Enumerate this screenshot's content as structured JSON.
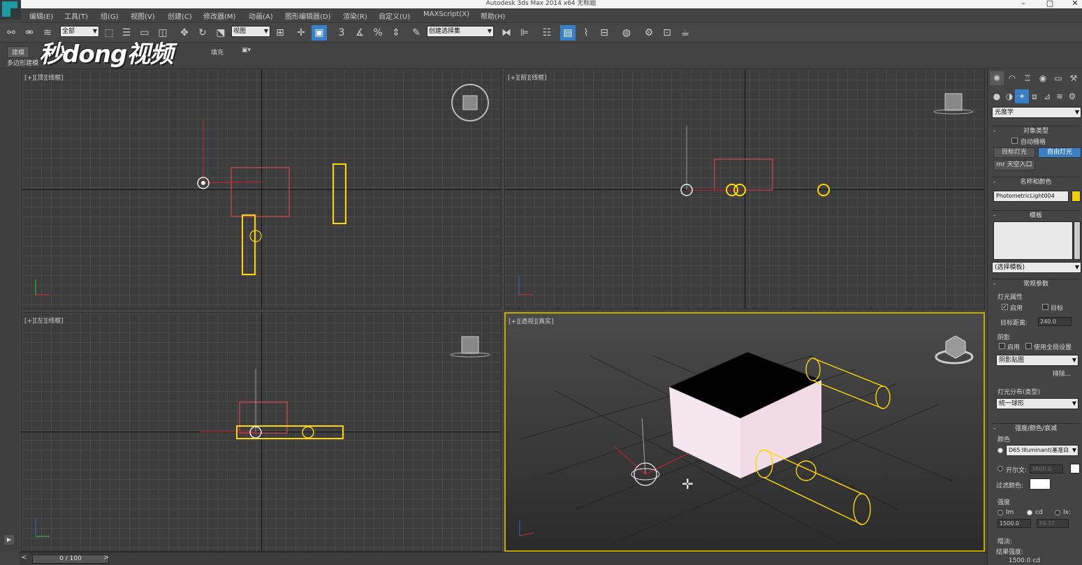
{
  "titlebar": {
    "title": "Autodesk 3ds Max  2014 x64     无标题"
  },
  "menu": [
    "编辑(E)",
    "工具(T)",
    "组(G)",
    "视图(V)",
    "创建(C)",
    "修改器(M)",
    "动画(A)",
    "图形编辑器(D)",
    "渲染(R)",
    "自定义(U)",
    "MAXScript(X)",
    "帮助(H)"
  ],
  "toolbar": {
    "filter_value": "全部",
    "refcoord_value": "视图",
    "selset_value": "创建选择集",
    "snap_num": "3"
  },
  "ribbon": {
    "tab_modeling": "建模",
    "tab_fill": "填充",
    "sub_label": "多边形建模"
  },
  "watermark": "秒dong视频",
  "viewports": {
    "top": "[+][顶][线框]",
    "front": "[+][前][线框]",
    "left": "[+][左][线框]",
    "persp": "[+][透视][真实]"
  },
  "cmd": {
    "category": "光度学",
    "obj_type_header": "对象类型",
    "autogrid": "自动栅格",
    "btn_target_light": "目标灯光",
    "btn_free_light": "自由灯光",
    "btn_sky_portal": "mr 天空入口",
    "name_color_header": "名称和颜色",
    "object_name": "PhotometricLight004",
    "object_color": "#f0d000",
    "template_header": "模板",
    "template_select": "(选择模板)",
    "general_header": "常规参数",
    "light_props": "灯光属性",
    "on_label": "启用",
    "target_label": "目标",
    "target_dist_label": "目标距离:",
    "target_dist_value": "240.0",
    "shadows_label": "阴影",
    "shadow_on": "启用",
    "use_global": "使用全局设置",
    "shadow_type": "阴影贴图",
    "exclude_btn": "排除...",
    "dist_header": "灯光分布(类型)",
    "dist_value": "统一球形",
    "intensity_header": "强度/颜色/衰减",
    "color_label": "颜色",
    "color_preset": "D65 Illuminant(基准白",
    "kelvin_label": "开尔文:",
    "kelvin_value": "3600.0",
    "filter_color_label": "过滤颜色:",
    "intensity_label": "强度",
    "unit_lm": "lm",
    "unit_cd": "cd",
    "unit_lx": "lx:",
    "intensity_value": "1500.0",
    "lx_value": "39.37",
    "dimming_label": "暗淡:",
    "result_label": "结果强度:",
    "result_value": "1500.0 cd"
  },
  "timeline": {
    "frame": "0 / 100"
  },
  "colors": {
    "light_yellow": "#ffd800",
    "select_red": "#d9434e",
    "active_border": "#c8a800"
  }
}
